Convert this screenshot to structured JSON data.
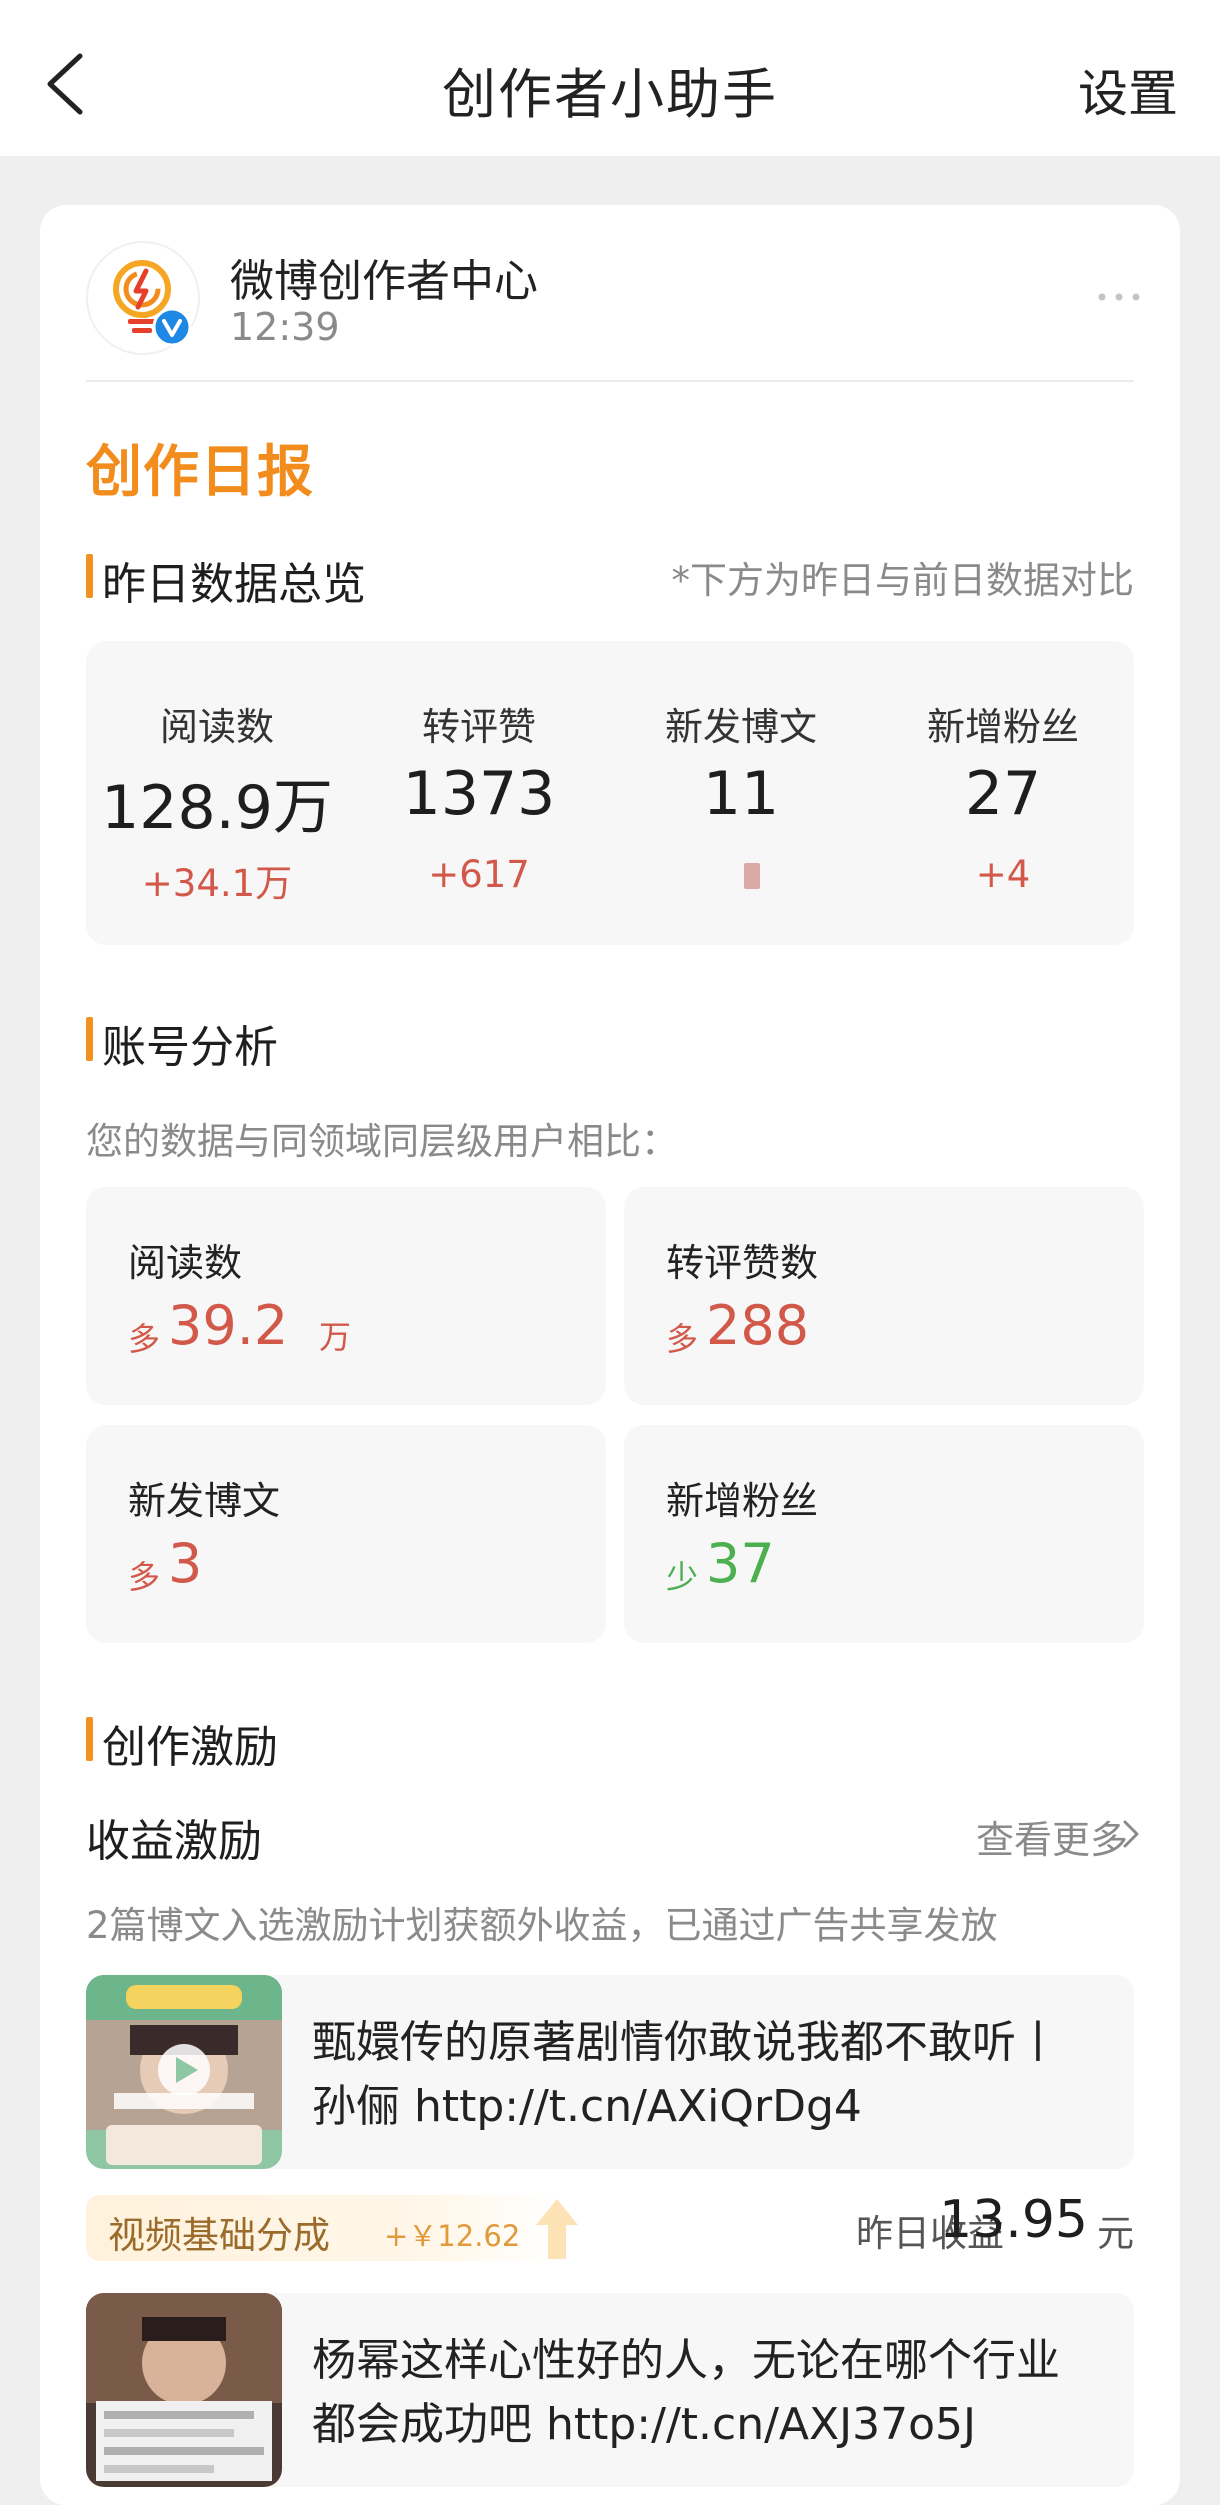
{
  "nav": {
    "title": "创作者小助手",
    "settings_label": "设置"
  },
  "message": {
    "sender": "微博创作者中心",
    "time": "12:39"
  },
  "report": {
    "title": "创作日报"
  },
  "overview": {
    "title": "昨日数据总览",
    "note": "*下方为昨日与前日数据对比",
    "stats": [
      {
        "label": "阅读数",
        "value": "128.9万",
        "delta": "+34.1万"
      },
      {
        "label": "转评赞",
        "value": "1373",
        "delta": "+617"
      },
      {
        "label": "新发博文",
        "value": "11",
        "delta": ""
      },
      {
        "label": "新增粉丝",
        "value": "27",
        "delta": "+4"
      }
    ]
  },
  "analysis": {
    "title": "账号分析",
    "subtitle": "您的数据与同领域同层级用户相比：",
    "items": [
      {
        "label": "阅读数",
        "prefix": "多",
        "value": "39.2",
        "unit": "万",
        "trend": "up"
      },
      {
        "label": "转评赞数",
        "prefix": "多",
        "value": "288",
        "unit": "",
        "trend": "up"
      },
      {
        "label": "新发博文",
        "prefix": "多",
        "value": "3",
        "unit": "",
        "trend": "up"
      },
      {
        "label": "新增粉丝",
        "prefix": "少",
        "value": "37",
        "unit": "",
        "trend": "down"
      }
    ]
  },
  "incentive": {
    "title": "创作激励",
    "income_title": "收益激励",
    "see_more": "查看更多",
    "description": "2篇博文入选激励计划获额外收益，已通过广告共享发放",
    "posts": [
      {
        "line1": "甄嬛传的原著剧情你敢说我都不敢听丨",
        "line2": "孙俪 http://t.cn/AXiQrDg4"
      },
      {
        "line1": "杨幂这样心性好的人，无论在哪个行业",
        "line2": "都会成功吧 http://t.cn/AXJ37o5J"
      }
    ],
    "earning_tag": "视频基础分成",
    "earning_amount": "+￥12.62",
    "yesterday_label": "昨日收益",
    "yesterday_value": "13.95",
    "yesterday_unit": "元"
  },
  "colors": {
    "accent_orange": "#f29020",
    "increase_red": "#d2584a",
    "decrease_green": "#4caf50",
    "verified_blue": "#1e88e5"
  }
}
